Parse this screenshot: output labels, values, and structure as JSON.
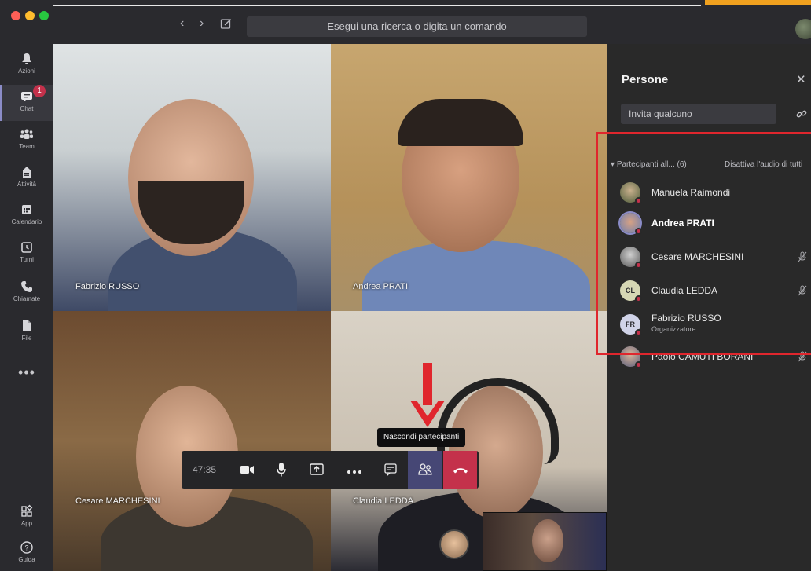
{
  "titlebar": {
    "search_placeholder": "Esegui una ricerca o digita un comando",
    "back_glyph": "‹",
    "forward_glyph": "›"
  },
  "rail": {
    "items": [
      {
        "label": "Azioni",
        "icon": "bell-icon"
      },
      {
        "label": "Chat",
        "icon": "chat-icon",
        "badge": "1"
      },
      {
        "label": "Team",
        "icon": "team-icon"
      },
      {
        "label": "Attività",
        "icon": "assignment-icon"
      },
      {
        "label": "Calendario",
        "icon": "calendar-icon"
      },
      {
        "label": "Turni",
        "icon": "shifts-icon"
      },
      {
        "label": "Chiamate",
        "icon": "phone-icon"
      },
      {
        "label": "File",
        "icon": "file-icon"
      },
      {
        "label": "App",
        "icon": "apps-icon"
      },
      {
        "label": "Guida",
        "icon": "help-icon"
      }
    ],
    "more": "•••"
  },
  "videos": [
    {
      "name": "Fabrizio RUSSO"
    },
    {
      "name": "Andrea PRATI"
    },
    {
      "name": "Cesare MARCHESINI"
    },
    {
      "name": "Claudia LEDDA"
    }
  ],
  "call": {
    "timer": "47:35",
    "tooltip": "Nascondi partecipanti"
  },
  "people_pane": {
    "title": "Persone",
    "close_glyph": "✕",
    "invite_placeholder": "Invita qualcuno",
    "section_label": "Partecipanti all... (6)",
    "mute_all_label": "Disattiva l'audio di tutti",
    "participants": [
      {
        "name": "Manuela Raimondi",
        "role": "",
        "initials": "",
        "bold": false,
        "muted": false
      },
      {
        "name": "Andrea PRATI",
        "role": "",
        "initials": "",
        "bold": true,
        "muted": false
      },
      {
        "name": "Cesare MARCHESINI",
        "role": "",
        "initials": "",
        "bold": false,
        "muted": true
      },
      {
        "name": "Claudia LEDDA",
        "role": "",
        "initials": "CL",
        "bold": false,
        "muted": true
      },
      {
        "name": "Fabrizio RUSSO",
        "role": "Organizzatore",
        "initials": "FR",
        "bold": false,
        "muted": false
      },
      {
        "name": "Paolo CAMUTI BORANI",
        "role": "",
        "initials": "",
        "bold": false,
        "muted": true
      }
    ]
  },
  "colors": {
    "accent": "#464775",
    "hangup": "#c4314b",
    "highlight": "#e0262d"
  }
}
